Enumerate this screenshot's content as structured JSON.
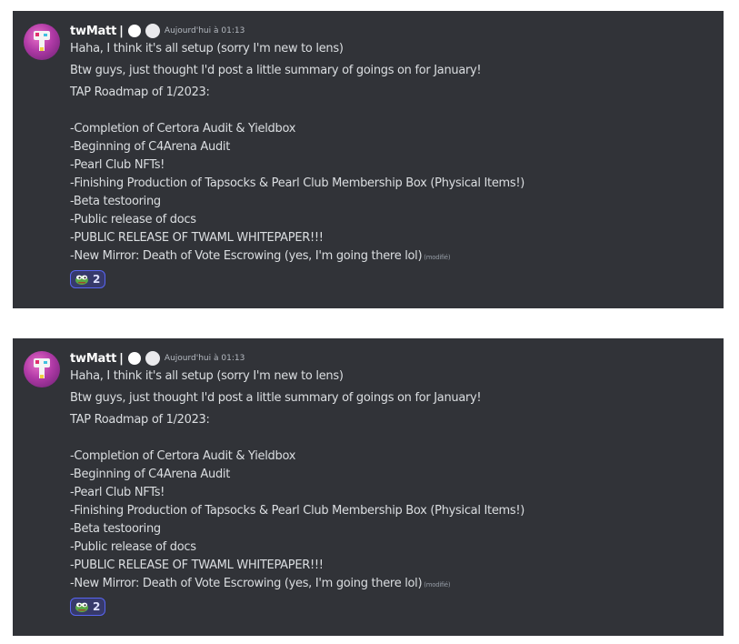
{
  "messages": [
    {
      "author": "twMatt",
      "separator": "|",
      "timestamp": "Aujourd'hui à 01:13",
      "lines": [
        "Haha, I think it's all setup (sorry I'm new to lens)",
        "Btw guys, just thought I'd post a little summary of goings on for January!",
        "TAP Roadmap of 1/2023:",
        "",
        "-Completion of Certora Audit & Yieldbox",
        "-Beginning of C4Arena Audit",
        "-Pearl Club NFTs!",
        "-Finishing Production of Tapsocks & Pearl Club Membership Box (Physical Items!)",
        "-Beta testooring",
        "-Public release of docs",
        "-PUBLIC RELEASE OF TWAML WHITEPAPER!!!",
        "-New Mirror: Death of Vote Escrowing (yes, I'm going there lol)"
      ],
      "edited_label": "(modifié)",
      "reaction": {
        "emoji": "pepe-frog-icon",
        "count": "2"
      }
    },
    {
      "author": "twMatt",
      "separator": "|",
      "timestamp": "Aujourd'hui à 01:13",
      "lines": [
        "Haha, I think it's all setup (sorry I'm new to lens)",
        "Btw guys, just thought I'd post a little summary of goings on for January!",
        "TAP Roadmap of 1/2023:",
        "",
        "-Completion of Certora Audit & Yieldbox",
        "-Beginning of C4Arena Audit",
        "-Pearl Club NFTs!",
        "-Finishing Production of Tapsocks & Pearl Club Membership Box (Physical Items!)",
        "-Beta testooring",
        "-Public release of docs",
        "-PUBLIC RELEASE OF TWAML WHITEPAPER!!!",
        "-New Mirror: Death of Vote Escrowing (yes, I'm going there lol)"
      ],
      "edited_label": "(modifié)",
      "reaction": {
        "emoji": "pepe-frog-icon",
        "count": "2"
      }
    }
  ],
  "colors": {
    "background": "#313338",
    "text": "#dbdee1",
    "username": "#ffffff",
    "timestamp": "#b5bac1",
    "reaction_border": "#5865f2"
  }
}
